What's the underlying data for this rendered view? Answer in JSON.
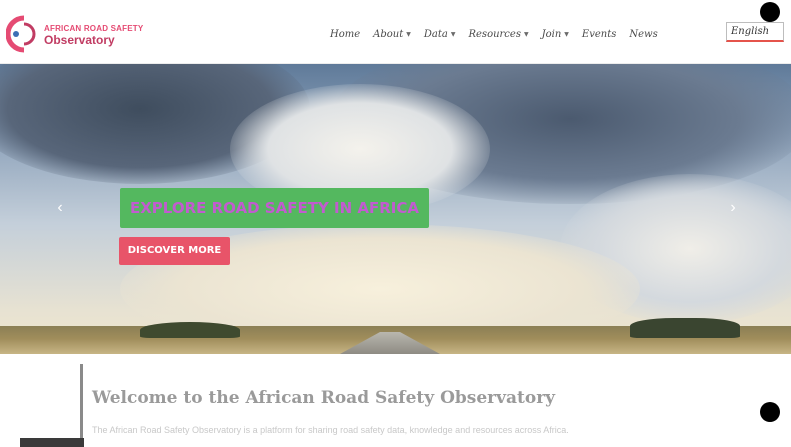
{
  "logo": {
    "line1": "AFRICAN ROAD SAFETY",
    "line2": "Observatory",
    "colors": {
      "primary": "#e54b73",
      "dark": "#c13c63"
    }
  },
  "nav": {
    "items": [
      {
        "label": "Home",
        "has_dropdown": false
      },
      {
        "label": "About",
        "has_dropdown": true
      },
      {
        "label": "Data",
        "has_dropdown": true
      },
      {
        "label": "Resources",
        "has_dropdown": true
      },
      {
        "label": "Join",
        "has_dropdown": true
      },
      {
        "label": "Events",
        "has_dropdown": false
      },
      {
        "label": "News",
        "has_dropdown": false
      }
    ],
    "caret_glyph": "▼"
  },
  "language": {
    "value": "English"
  },
  "hero": {
    "title": "EXPLORE ROAD SAFETY IN AFRICA",
    "button_label": "DISCOVER MORE",
    "prev_glyph": "‹",
    "next_glyph": "›",
    "colors": {
      "title_bg": "#54b85f",
      "button_bg": "#e85469"
    }
  },
  "welcome": {
    "title": "Welcome to the African Road Safety Observatory",
    "text": "The African Road Safety Observatory is a platform for sharing road safety data, knowledge and resources across Africa."
  }
}
